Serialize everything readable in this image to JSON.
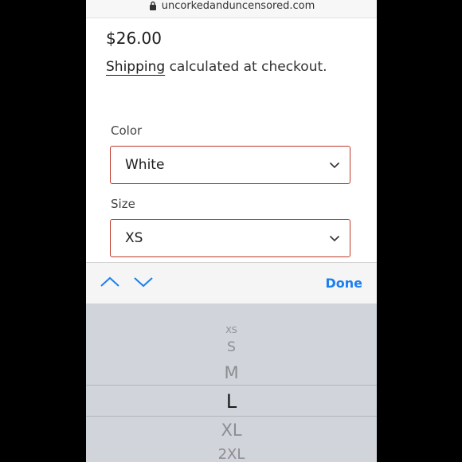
{
  "browser": {
    "url": "uncorkedanduncensored.com"
  },
  "product": {
    "price": "$26.00",
    "shipping_link": "Shipping",
    "shipping_text": " calculated at checkout."
  },
  "options": {
    "color_label": "Color",
    "color_value": "White",
    "size_label": "Size",
    "size_value": "XS"
  },
  "keyboard_toolbar": {
    "done_label": "Done",
    "accent_color": "#1a7ff0"
  },
  "picker": {
    "options": [
      "XS",
      "S",
      "M",
      "L",
      "XL",
      "2XL"
    ],
    "selected": "L"
  },
  "colors": {
    "field_border": "#c0392b",
    "picker_background": "#d1d4da"
  }
}
